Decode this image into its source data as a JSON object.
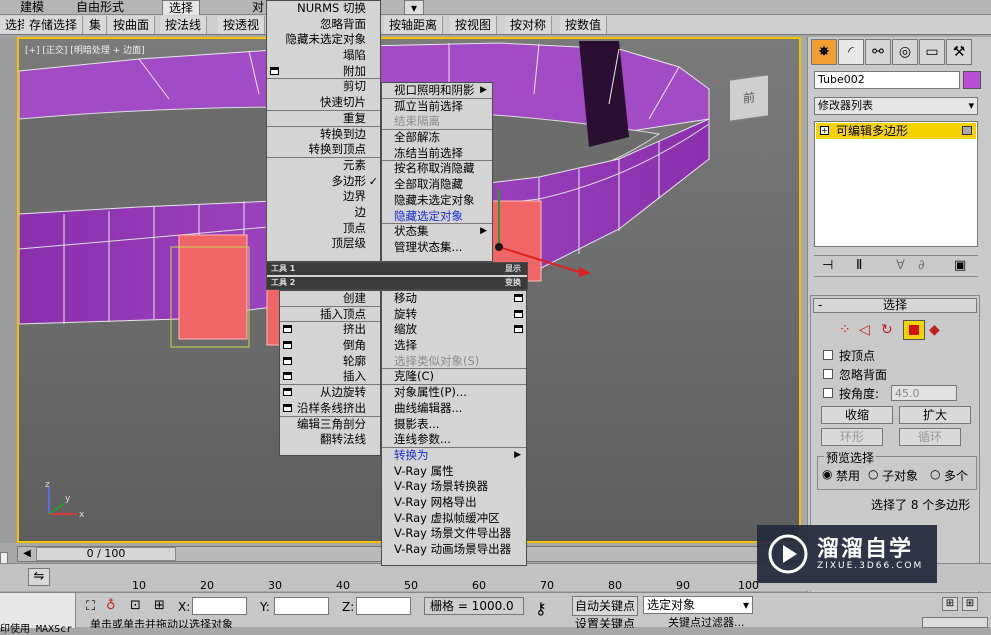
{
  "ribbon": {
    "tabs": [
      "建模",
      "自由形式",
      "选择",
      "对"
    ],
    "active_tab": "选择",
    "row_buttons_left": [
      "选择",
      "存储选择",
      "集",
      "按曲面",
      "按法线",
      "按透视"
    ],
    "row_buttons_right": [
      "按轴距离",
      "按视图",
      "按对称",
      "按数值"
    ]
  },
  "viewport": {
    "label": "[+] [正交] [明暗处理 + 边面]",
    "viewcube_label": "前",
    "axis_x": "x",
    "axis_y": "y",
    "axis_z": "z",
    "colors": {
      "border": "#f2c200",
      "mesh": "#9a3fb8",
      "selected_face": "#f06060"
    }
  },
  "quad_menu_left": {
    "items_top": [
      "NURMS 切换",
      "忽略背面",
      "隐藏未选定对象",
      "塌陷",
      "附加",
      "剪切",
      "快速切片",
      "重复",
      "转换到边",
      "转换到顶点",
      "元素",
      "多边形",
      "边界",
      "边",
      "顶点",
      "顶层级"
    ],
    "checked_item": "多边形",
    "section1": "工具 1",
    "section2": "工具 2",
    "items_bottom": [
      "创建",
      "插入顶点",
      "挤出",
      "倒角",
      "轮廓",
      "插入",
      "从边旋转",
      "沿样条线挤出",
      "编辑三角剖分",
      "翻转法线"
    ]
  },
  "quad_menu_right": {
    "items_top": [
      "视口照明和阴影",
      "孤立当前选择",
      "结束隔离",
      "全部解冻",
      "冻结当前选择",
      "按名称取消隐藏",
      "全部取消隐藏",
      "隐藏未选定对象",
      "隐藏选定对象",
      "状态集",
      "管理状态集..."
    ],
    "section1": "显示",
    "section2": "变换",
    "items_bottom": [
      "移动",
      "旋转",
      "缩放",
      "选择",
      "选择类似对象(S)",
      "克隆(C)",
      "对象属性(P)...",
      "曲线编辑器...",
      "摄影表...",
      "连线参数...",
      "转换为",
      "V-Ray 属性",
      "V-Ray 场景转换器",
      "V-Ray 网格导出",
      "V-Ray 虚拟帧缓冲区",
      "V-Ray 场景文件导出器",
      "V-Ray 动画场景导出器"
    ],
    "disabled": [
      "结束隔离",
      "选择类似对象(S)"
    ],
    "highlighted": [
      "隐藏选定对象",
      "转换为"
    ]
  },
  "command_panel": {
    "object_name": "Tube002",
    "object_color": "#b84fd0",
    "modifier_list": "修改器列表",
    "stack_item": "可编辑多边形",
    "rollout_title": "选择",
    "cb_vertex": "按顶点",
    "cb_backface": "忽略背面",
    "cb_angle": "按角度:",
    "angle_value": "45.0",
    "shrink": "收缩",
    "grow": "扩大",
    "ring": "环形",
    "loop": "循环",
    "preview_group": "预览选择",
    "radio_disabled": "禁用",
    "radio_subobject": "子对象",
    "radio_multi": "多个",
    "status_text": "选择了 8 个多边形"
  },
  "timeline": {
    "frame": "0 / 100"
  },
  "ruler_ticks": [
    "10",
    "20",
    "30",
    "40",
    "50",
    "60",
    "70",
    "80",
    "90",
    "100"
  ],
  "status_bar": {
    "x_label": "X:",
    "y_label": "Y:",
    "z_label": "Z:",
    "grid": "栅格 = 1000.0",
    "auto_key": "自动关键点",
    "set_key": "设置关键点",
    "selected_object": "选定对象",
    "key_filter": "关键点过滤器...",
    "left_msg1": "印使用 MAXScr",
    "left_msg2": "单击或单击并拖动以选择对象"
  },
  "watermark": {
    "brand": "溜溜自学",
    "url": "ZIXUE.3D66.COM"
  }
}
